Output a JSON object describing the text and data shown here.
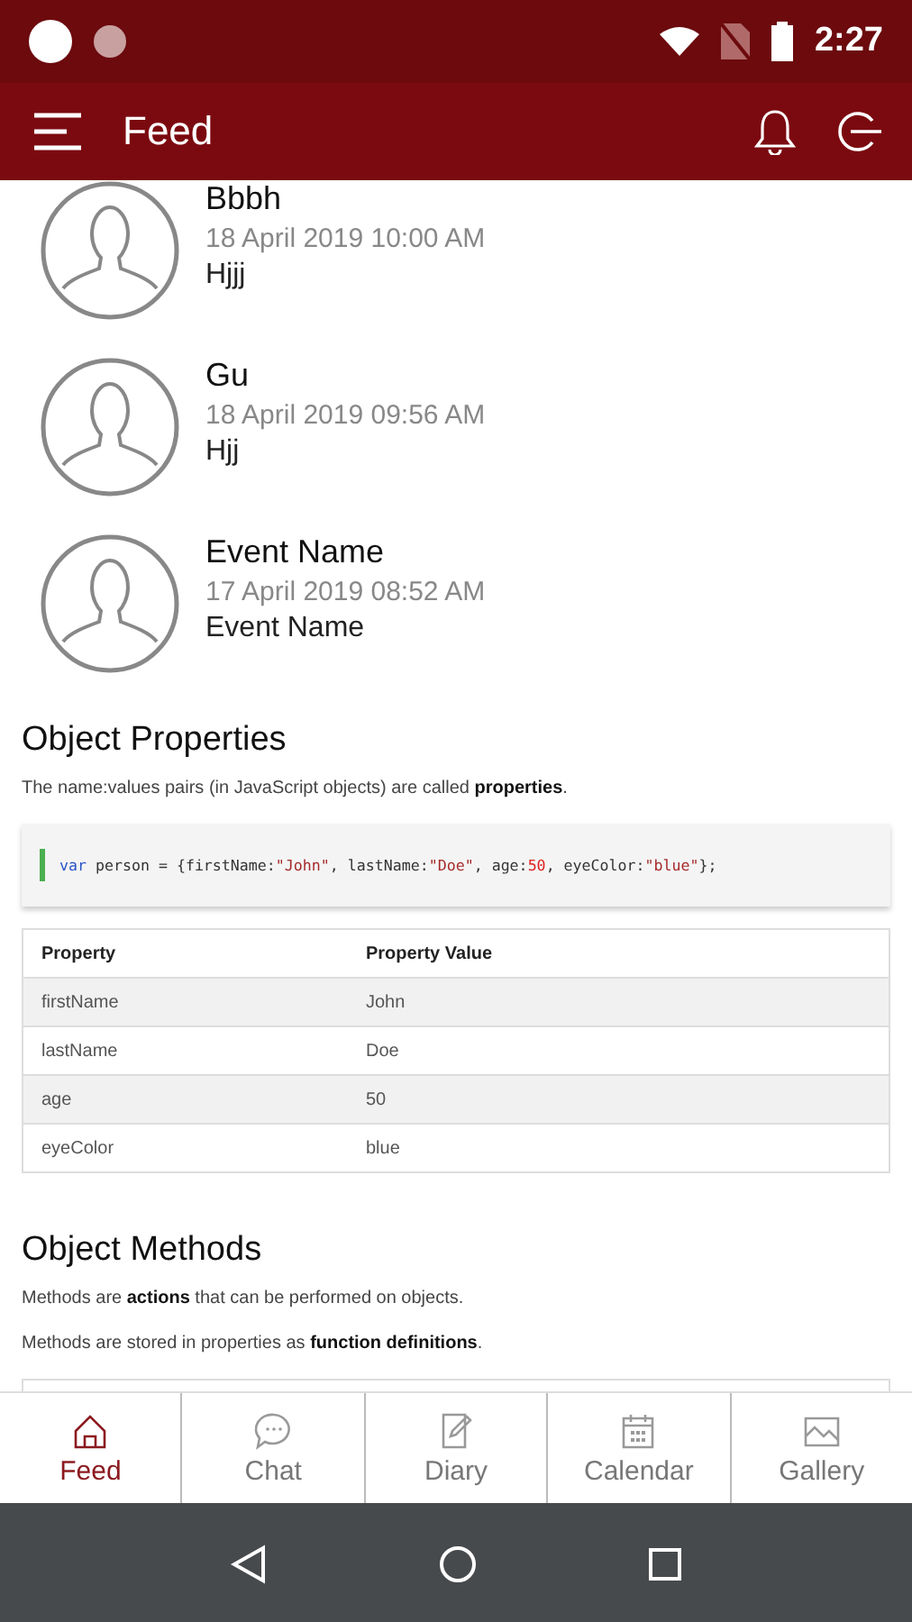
{
  "status_bar": {
    "time": "2:27"
  },
  "app_bar": {
    "title": "Feed"
  },
  "feed": [
    {
      "name": "Bbbh",
      "date": "18 April 2019 10:00 AM",
      "text": "Hjjj"
    },
    {
      "name": "Gu",
      "date": "18 April 2019 09:56 AM",
      "text": "Hjj"
    },
    {
      "name": "Event Name",
      "date": "17 April 2019 08:52 AM",
      "text": "Event Name"
    }
  ],
  "article": {
    "heading_1": "Object Properties",
    "paragraph_1": "The name:values pairs (in JavaScript objects) are called **properties**.",
    "code": [
      {
        "kind": "keyword",
        "text": "var"
      },
      {
        "kind": "plain",
        "text": " person = {firstName:"
      },
      {
        "kind": "string",
        "text": "\"John\""
      },
      {
        "kind": "plain",
        "text": ", lastName:"
      },
      {
        "kind": "string",
        "text": "\"Doe\""
      },
      {
        "kind": "plain",
        "text": ", age:"
      },
      {
        "kind": "number",
        "text": "50"
      },
      {
        "kind": "plain",
        "text": ", eyeColor:"
      },
      {
        "kind": "string",
        "text": "\"blue\""
      },
      {
        "kind": "plain",
        "text": "};"
      }
    ],
    "table": {
      "columns": [
        "Property",
        "Property Value"
      ],
      "rows": [
        [
          "firstName",
          "John"
        ],
        [
          "lastName",
          "Doe"
        ],
        [
          "age",
          "50"
        ],
        [
          "eyeColor",
          "blue"
        ]
      ]
    },
    "heading_2": "Object Methods",
    "paragraph_2": "Methods are **actions** that can be performed on objects.",
    "paragraph_3": "Methods are stored in properties as **function definitions**."
  },
  "bottom_nav": [
    {
      "kind": "home",
      "label": "Feed",
      "selected": true
    },
    {
      "kind": "chat",
      "label": "Chat",
      "selected": false
    },
    {
      "kind": "diary",
      "label": "Diary",
      "selected": false
    },
    {
      "kind": "calendar",
      "label": "Calendar",
      "selected": false
    },
    {
      "kind": "gallery",
      "label": "Gallery",
      "selected": false
    }
  ]
}
